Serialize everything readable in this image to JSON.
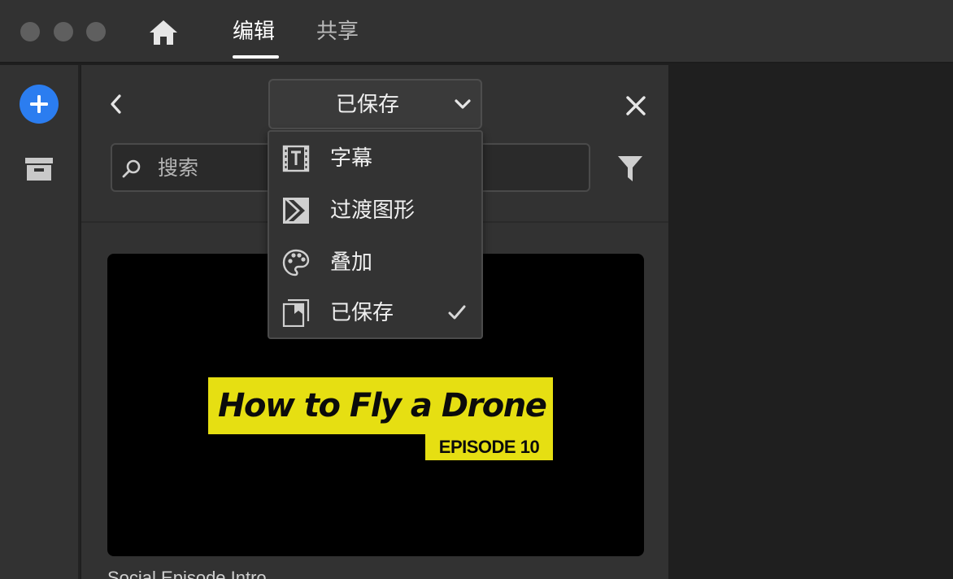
{
  "window": {
    "controls": [
      "close",
      "minimize",
      "zoom"
    ]
  },
  "top_nav": {
    "home_icon": "home-icon",
    "tabs": [
      {
        "label": "编辑",
        "active": true
      },
      {
        "label": "共享",
        "active": false
      }
    ]
  },
  "left_rail": {
    "add_icon": "plus-icon",
    "archive_icon": "archive-icon",
    "accent_color": "#2b7df0"
  },
  "panel": {
    "back_icon": "chevron-left-icon",
    "close_icon": "close-icon",
    "category_select": {
      "selected": "已保存",
      "icon": "chevron-down-icon"
    },
    "search": {
      "placeholder": "搜索",
      "value": "",
      "icon": "search-icon"
    },
    "filter_icon": "filter-icon"
  },
  "dropdown": {
    "items": [
      {
        "label": "字幕",
        "icon": "title-icon",
        "checked": false
      },
      {
        "label": "过渡图形",
        "icon": "transition-icon",
        "checked": false
      },
      {
        "label": "叠加",
        "icon": "palette-icon",
        "checked": false
      },
      {
        "label": "已保存",
        "icon": "saved-icon",
        "checked": true
      }
    ],
    "check_icon": "checkmark-icon"
  },
  "template_card": {
    "title": "How to Fly a Drone",
    "subtitle": "EPISODE 10",
    "caption": "Social Episode Intro",
    "highlight_color": "#e6df12"
  }
}
